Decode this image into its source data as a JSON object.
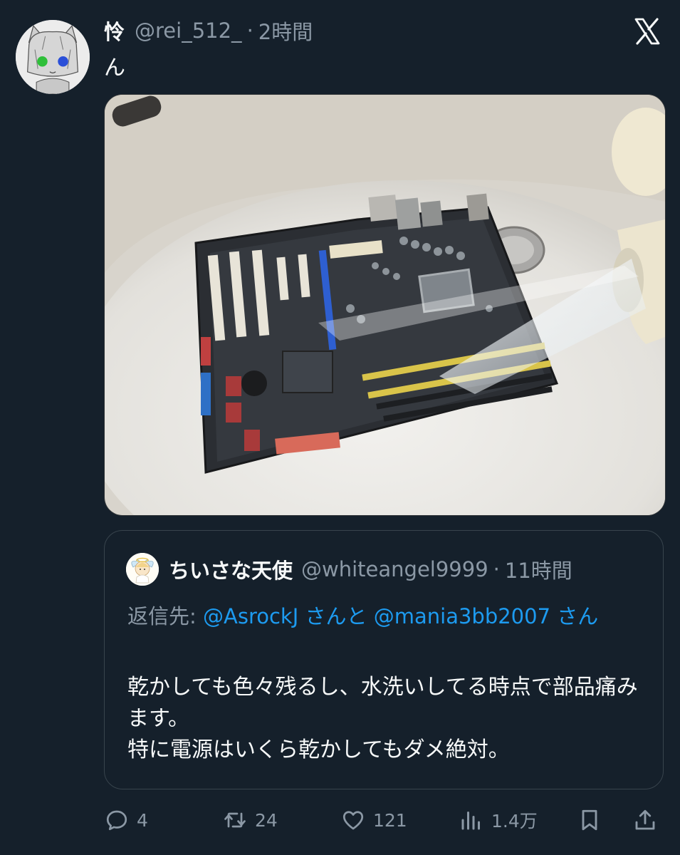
{
  "tweet": {
    "author_name": "怜",
    "handle": "@rei_512_",
    "separator": "·",
    "time": "2時間",
    "text": "ん",
    "media_icon": "motherboard-in-sink-photo"
  },
  "quote": {
    "author_name": "ちいさな天使",
    "handle": "@whiteangel9999",
    "separator": "·",
    "time": "11時間",
    "reply_prefix": "返信先: ",
    "mention1": "@AsrockJ",
    "mention_joiner": "さんと",
    "mention2": "@mania3bb2007",
    "mention_suffix": "さん",
    "body_lines": [
      "乾かしても色々残るし、水洗いしてる時点で部品痛みます。",
      "特に電源はいくら乾かしてもダメ絶対。"
    ]
  },
  "actions": {
    "reply_count": "4",
    "retweet_count": "24",
    "like_count": "121",
    "views_count": "1.4万"
  },
  "colors": {
    "background": "#15202b",
    "text_primary": "#f7f9f9",
    "text_secondary": "#8b98a5",
    "link": "#1d9bf0",
    "border": "#38444d"
  },
  "icons": [
    "x-logo-icon",
    "reply-icon",
    "retweet-icon",
    "like-icon",
    "views-icon",
    "bookmark-icon",
    "share-icon"
  ]
}
